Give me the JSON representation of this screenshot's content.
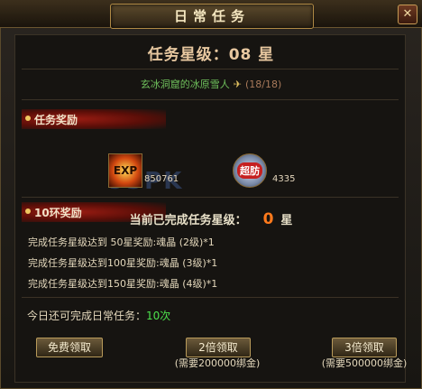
{
  "window": {
    "title": "日常任务",
    "close_label": "✕"
  },
  "header": {
    "star_label": "任务星级：08 星"
  },
  "quest": {
    "location": "玄冰洞窟的冰原雪人",
    "progress": "(18/18)"
  },
  "rewards_section": {
    "title": "任务奖励",
    "items": [
      {
        "icon": "exp-icon",
        "icon_text": "EXP",
        "value": "850761"
      },
      {
        "icon": "chao-icon",
        "icon_text": "超肪",
        "value": "4335"
      }
    ]
  },
  "ring_section": {
    "title": "10环奖励",
    "status_label": "当前已完成任务星级：",
    "status_value": "0",
    "status_unit": "星",
    "tiers": [
      "完成任务星级达到  50星奖励:魂晶 (2级)*1",
      "完成任务星级达到100星奖励:魂晶 (3级)*1",
      "完成任务星级达到150星奖励:魂晶 (4级)*1"
    ]
  },
  "remaining": {
    "label": "今日还可完成日常任务：",
    "count": "10次"
  },
  "actions": {
    "free": {
      "label": "免费领取"
    },
    "double": {
      "label": "2倍领取",
      "note": "(需要200000绑金)"
    },
    "triple": {
      "label": "3倍领取",
      "note": "(需要500000绑金)"
    }
  },
  "watermark": "93PK",
  "colors": {
    "accent": "#ff7a1c",
    "quest_green": "#6fc05c",
    "count_green": "#4ce04c",
    "banner_red": "#9b1c12"
  }
}
